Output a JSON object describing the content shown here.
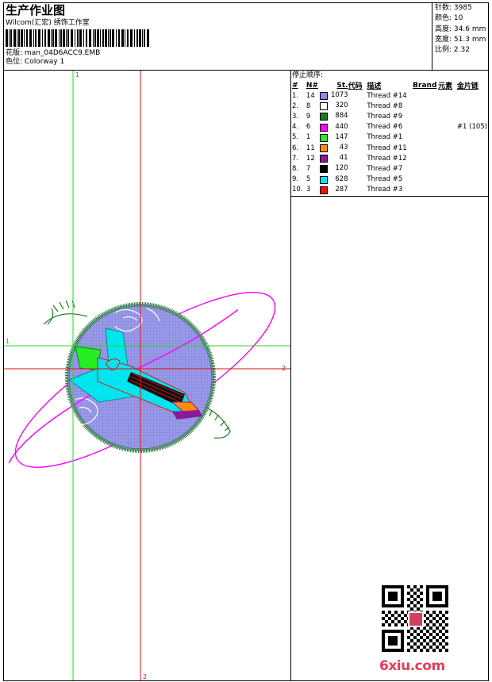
{
  "header": {
    "title": "生产作业图",
    "subtitle": "Wilcom(汇宏) 绣饰工作室",
    "design_label": "花版:",
    "design_file": "man_04D6ACC9.EMB",
    "colorway_label": "色位:",
    "colorway": "Colorway 1"
  },
  "stats": [
    {
      "label": "针数:",
      "value": "3985"
    },
    {
      "label": "颜色:",
      "value": "10"
    },
    {
      "label": "高度:",
      "value": "34.6 mm"
    },
    {
      "label": "宽度:",
      "value": "51.3 mm"
    },
    {
      "label": "比例:",
      "value": "2.32"
    }
  ],
  "stop_sequence": {
    "title": "停止顺序:",
    "columns": [
      "#",
      "N#",
      "St.",
      "代码",
      "描述",
      "Brand",
      "元素",
      "金片链"
    ],
    "rows": [
      {
        "idx": "1.",
        "n": "14",
        "color": "#8888ee",
        "st": "1073",
        "code": "",
        "desc": "Thread #14",
        "brand": "",
        "elem": "",
        "seq": ""
      },
      {
        "idx": "2.",
        "n": "8",
        "color": "#ffffff",
        "st": "320",
        "code": "",
        "desc": "Thread #8",
        "brand": "",
        "elem": "",
        "seq": ""
      },
      {
        "idx": "3.",
        "n": "9",
        "color": "#1b7a1b",
        "st": "884",
        "code": "",
        "desc": "Thread #9",
        "brand": "",
        "elem": "",
        "seq": ""
      },
      {
        "idx": "4.",
        "n": "6",
        "color": "#ff00ff",
        "st": "440",
        "code": "",
        "desc": "Thread #6",
        "brand": "",
        "elem": "",
        "seq": "#1 (105)"
      },
      {
        "idx": "5.",
        "n": "1",
        "color": "#22ee22",
        "st": "147",
        "code": "",
        "desc": "Thread #1",
        "brand": "",
        "elem": "",
        "seq": ""
      },
      {
        "idx": "6.",
        "n": "11",
        "color": "#ff8c00",
        "st": "43",
        "code": "",
        "desc": "Thread #11",
        "brand": "",
        "elem": "",
        "seq": ""
      },
      {
        "idx": "7.",
        "n": "12",
        "color": "#8b1a9a",
        "st": "41",
        "code": "",
        "desc": "Thread #12",
        "brand": "",
        "elem": "",
        "seq": ""
      },
      {
        "idx": "8.",
        "n": "7",
        "color": "#000000",
        "st": "120",
        "code": "",
        "desc": "Thread #7",
        "brand": "",
        "elem": "",
        "seq": ""
      },
      {
        "idx": "9.",
        "n": "5",
        "color": "#00e5ee",
        "st": "628",
        "code": "",
        "desc": "Thread #5",
        "brand": "",
        "elem": "",
        "seq": ""
      },
      {
        "idx": "10.",
        "n": "3",
        "color": "#ee1111",
        "st": "287",
        "code": "",
        "desc": "Thread #3",
        "brand": "",
        "elem": "",
        "seq": ""
      }
    ]
  },
  "axes": {
    "green_v_label": "1",
    "green_h_label": "1",
    "red_h_label": "2",
    "red_v_label": "2",
    "green_color": "#22dd22",
    "red_color": "#dd1111"
  },
  "watermark": "6xiu.com"
}
